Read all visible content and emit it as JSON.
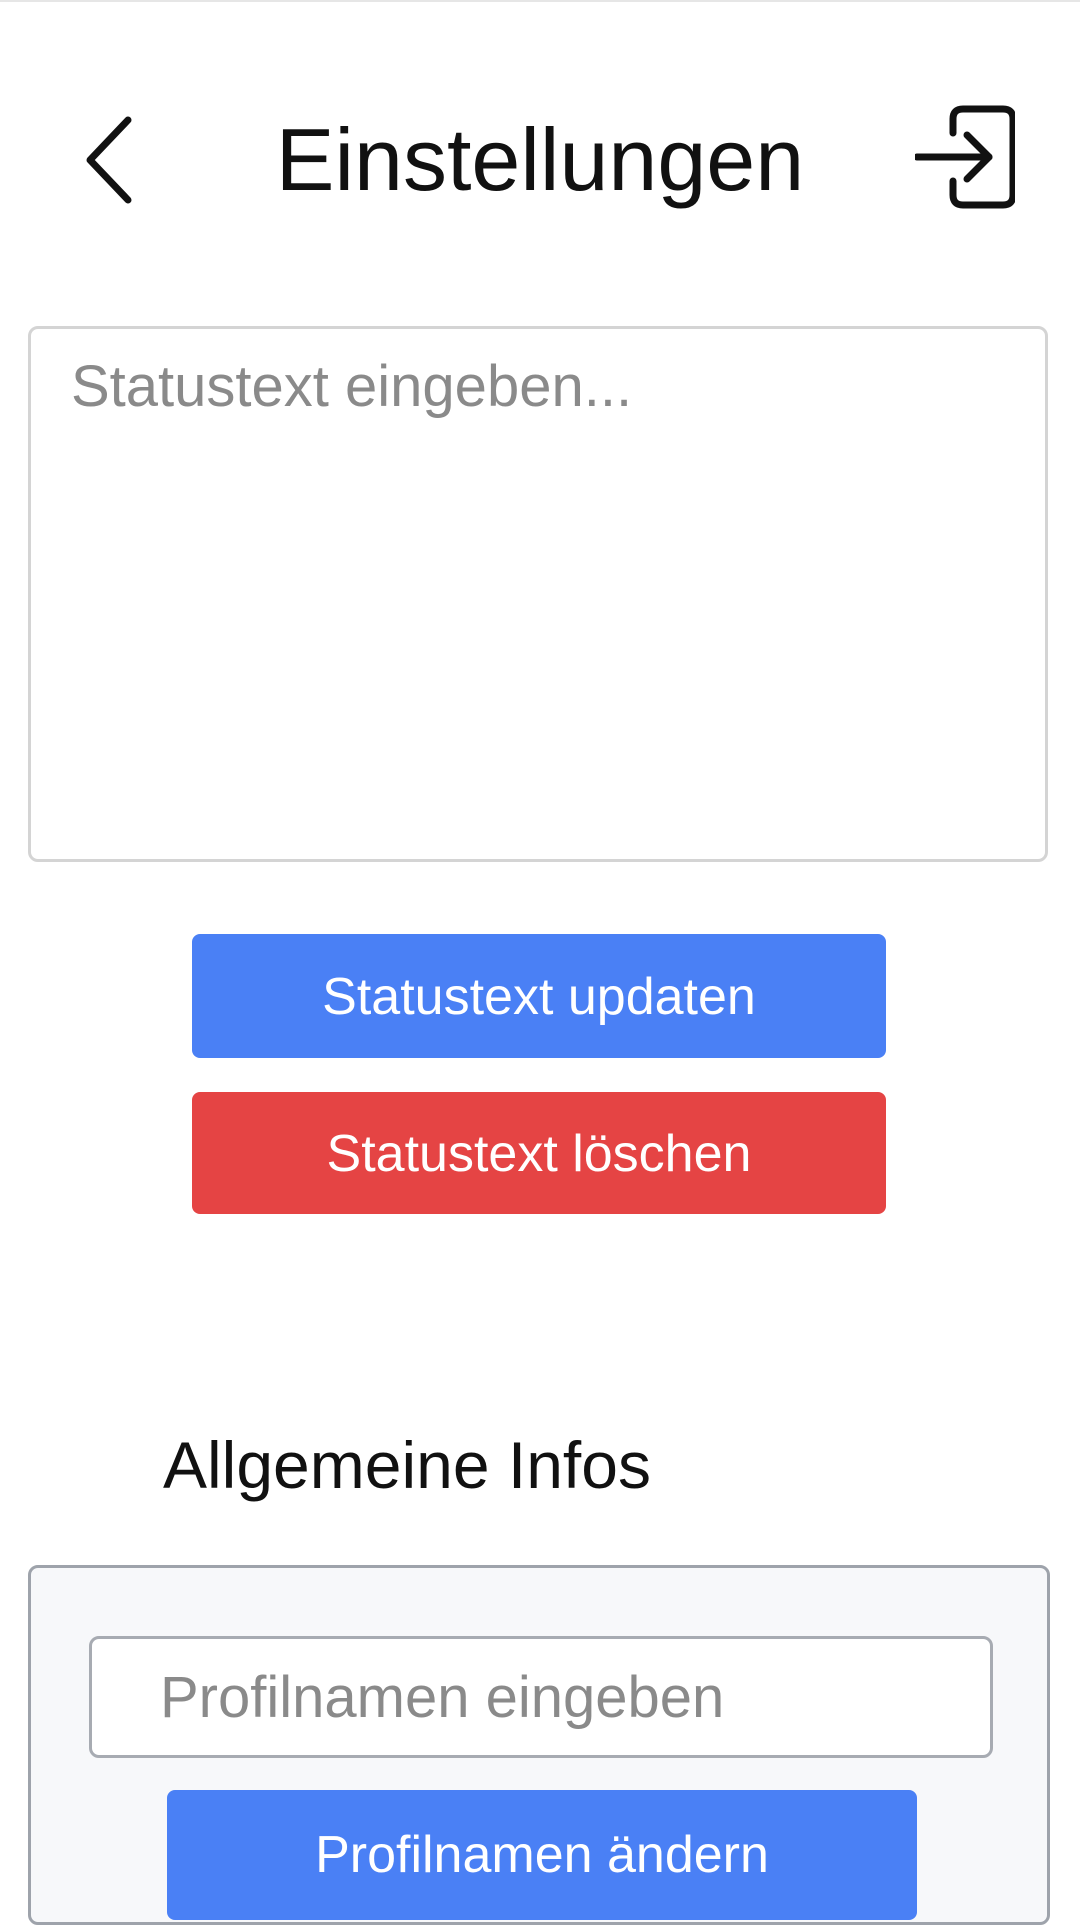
{
  "header": {
    "title": "Einstellungen",
    "back_icon": "chevron-left-icon",
    "logout_icon": "login-arrow-icon"
  },
  "status": {
    "placeholder": "Statustext eingeben...",
    "value": "",
    "update_label": "Statustext updaten",
    "delete_label": "Statustext löschen"
  },
  "general_info": {
    "title": "Allgemeine Infos",
    "profile_placeholder": "Profilnamen eingeben",
    "profile_value": "",
    "change_label": "Profilnamen ändern"
  },
  "colors": {
    "primary": "#4a80f5",
    "danger": "#e54444",
    "text": "#111111",
    "placeholder": "#8a8a8a"
  }
}
